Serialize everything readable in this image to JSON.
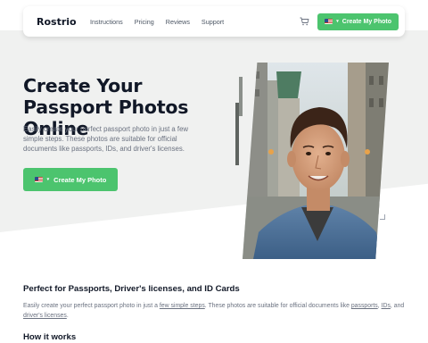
{
  "brand": {
    "name": "Rostrio",
    "accent": "#4cc46e"
  },
  "nav": {
    "links": [
      "Instructions",
      "Pricing",
      "Reviews",
      "Support"
    ],
    "cart_icon": "cart-icon",
    "cta_label": "Create My Photo",
    "cta_flag": "us-flag-icon"
  },
  "hero": {
    "title": "Create Your Passport Photos Online",
    "subtitle": "Easily create your perfect passport photo in just a few simple steps. These photos are suitable for official documents like passports, IDs, and driver's licenses.",
    "cta_label": "Create My Photo",
    "cta_flag": "us-flag-icon"
  },
  "section": {
    "title": "Perfect for Passports, Driver's licenses, and ID Cards",
    "body_parts": {
      "p1": "Easily create your perfect passport photo in just a ",
      "link1": "few simple steps",
      "p2": ". These photos are suitable for official documents like ",
      "link2": "passports",
      "p3": ", ",
      "link3": "IDs",
      "p4": ", and ",
      "link4": "driver's licenses",
      "p5": "."
    }
  },
  "how": {
    "title": "How it works"
  }
}
